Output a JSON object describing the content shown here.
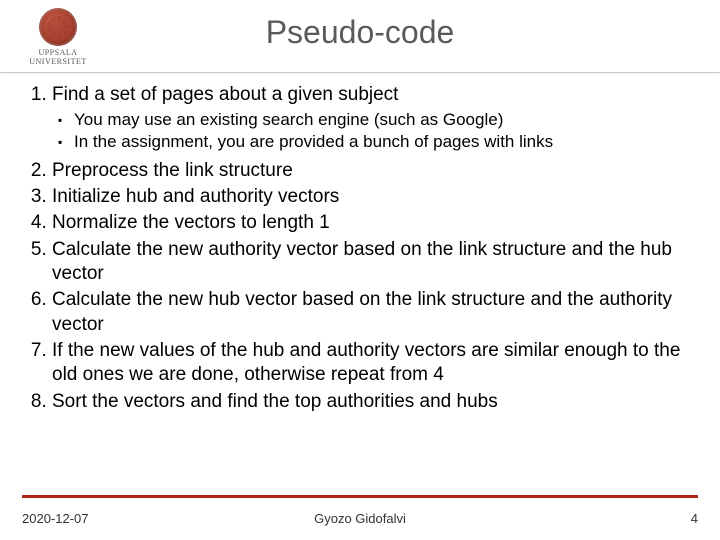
{
  "header": {
    "university": "UPPSALA UNIVERSITET",
    "title": "Pseudo-code"
  },
  "steps": [
    {
      "text": "Find a set of pages about a given subject",
      "sub": [
        "You may use an existing search engine (such as Google)",
        "In the assignment, you are provided a bunch of pages with links"
      ]
    },
    {
      "text": "Preprocess the link structure"
    },
    {
      "text": "Initialize hub and authority vectors"
    },
    {
      "text": "Normalize the vectors to length 1"
    },
    {
      "text": "Calculate the new authority vector based on the link structure and the hub vector"
    },
    {
      "text": "Calculate the new hub vector based on the link structure and the authority vector"
    },
    {
      "text": "If the new values of the hub and authority vectors are similar enough to the old ones we are done, otherwise repeat from 4"
    },
    {
      "text": "Sort the vectors and find the top authorities and hubs"
    }
  ],
  "footer": {
    "date": "2020-12-07",
    "author": "Gyozo Gidofalvi",
    "page": "4"
  }
}
